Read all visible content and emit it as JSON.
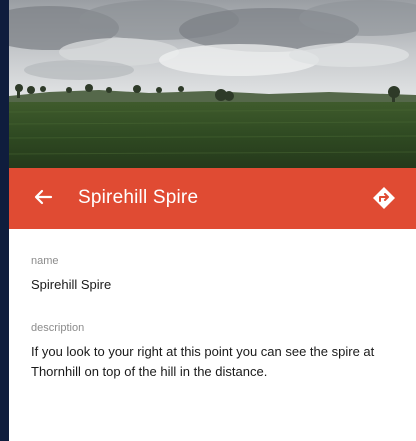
{
  "header": {
    "image": "landscape-photo",
    "title": "Spirehill Spire",
    "back_icon": "arrow-back-icon",
    "directions_icon": "directions-icon"
  },
  "details": {
    "name_label": "name",
    "name_value": "Spirehill Spire",
    "description_label": "description",
    "description_value": "If you look to your right at this point you can see the spire at Thornhill on top of the hill in the distance."
  },
  "colors": {
    "app_bar": "#e04b33",
    "left_edge": "#0f1d3d",
    "label": "#8c8c8c",
    "text": "#1a1a1a"
  }
}
